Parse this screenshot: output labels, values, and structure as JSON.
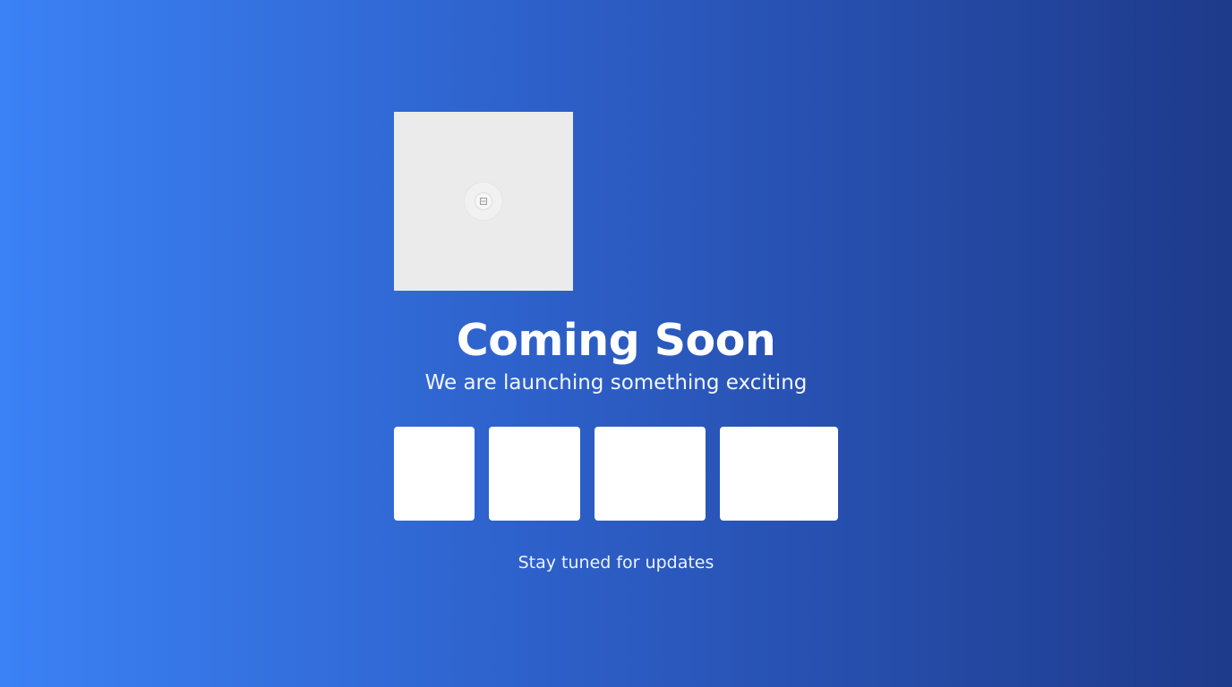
{
  "page": {
    "title": "Coming Soon",
    "subtitle": "We are launching something exciting",
    "footer": "Stay tuned for updates"
  },
  "logo": {
    "icon": "image-placeholder-icon"
  },
  "countdown": {
    "boxes": [
      "",
      "",
      "",
      ""
    ]
  },
  "colors": {
    "gradient_start": "#3b82f6",
    "gradient_end": "#1e3a8a",
    "text": "#ffffff",
    "box": "#ffffff",
    "placeholder": "#ebebeb"
  }
}
